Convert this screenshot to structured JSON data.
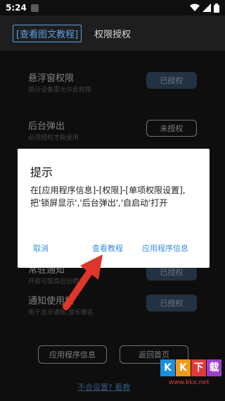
{
  "status_bar": {
    "time": "5:24"
  },
  "header": {
    "tab_tutorial": "[查看图文教程]",
    "tab_permission": "权限授权"
  },
  "permissions": [
    {
      "title": "悬浮窗权限",
      "desc": "部分设备需允许此权限",
      "button": "已授权",
      "state": "granted"
    },
    {
      "title": "后台弹出",
      "desc": "必须授权才能使用",
      "button": "未授权",
      "state": "not_granted"
    },
    {
      "title": "常驻通知",
      "desc": "开启可提高后台稳定",
      "button": "已授权",
      "state": "granted"
    },
    {
      "title": "通知使用权",
      "desc": "用于显示通知,音乐歌名",
      "button": "已授权",
      "state": "granted"
    }
  ],
  "bottom": {
    "app_info": "应用程序信息",
    "back_home": "返回首页",
    "help_link": "不会设置? 看教"
  },
  "dialog": {
    "title": "提示",
    "body": "在[应用程序信息]-[权限]-[单项权限设置],把'锁屏显示','后台弹出','自启动'打开",
    "cancel": "取消",
    "view_tutorial": "查看教程",
    "app_info": "应用程序信息"
  },
  "watermark": {
    "chars": [
      "K",
      "K",
      "下",
      "载"
    ],
    "url": "www.kkx.net"
  },
  "colors": {
    "accent": "#3a8ee6",
    "granted_button": "#3f5b78",
    "arrow": "#e0352b"
  }
}
